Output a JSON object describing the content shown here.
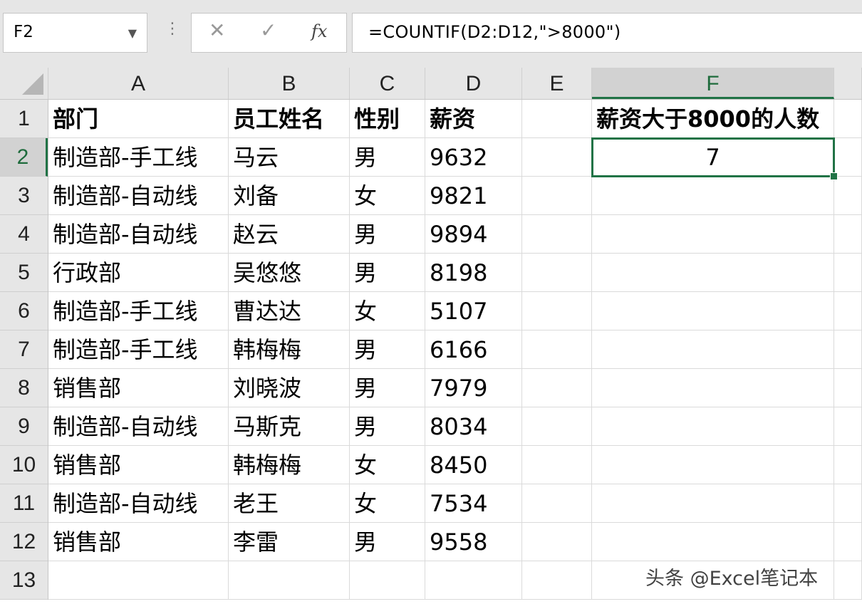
{
  "formula_bar": {
    "name_box": "F2",
    "name_box_arrow": "▼",
    "menu_dots": "⋮",
    "cancel_icon": "✕",
    "enter_icon": "✓",
    "fx_label": "fx",
    "formula": "=COUNTIF(D2:D12,\">8000\")"
  },
  "columns": [
    "A",
    "B",
    "C",
    "D",
    "E",
    "F"
  ],
  "active_column": "F",
  "rows": [
    "1",
    "2",
    "3",
    "4",
    "5",
    "6",
    "7",
    "8",
    "9",
    "10",
    "11",
    "12",
    "13"
  ],
  "active_row": "2",
  "table": {
    "headers": [
      "部门",
      "员工姓名",
      "性别",
      "薪资"
    ],
    "records": [
      [
        "制造部-手工线",
        "马云",
        "男",
        "9632"
      ],
      [
        "制造部-自动线",
        "刘备",
        "女",
        "9821"
      ],
      [
        "制造部-自动线",
        "赵云",
        "男",
        "9894"
      ],
      [
        "行政部",
        "吴悠悠",
        "男",
        "8198"
      ],
      [
        "制造部-手工线",
        "曹达达",
        "女",
        "5107"
      ],
      [
        "制造部-手工线",
        "韩梅梅",
        "男",
        "6166"
      ],
      [
        "销售部",
        "刘晓波",
        "男",
        "7979"
      ],
      [
        "制造部-自动线",
        "马斯克",
        "男",
        "8034"
      ],
      [
        "销售部",
        "韩梅梅",
        "女",
        "8450"
      ],
      [
        "制造部-自动线",
        "老王",
        "女",
        "7534"
      ],
      [
        "销售部",
        "李雷",
        "男",
        "9558"
      ]
    ]
  },
  "summary": {
    "label": "薪资大于8000的人数",
    "value": "7"
  },
  "watermark": "头条 @Excel笔记本",
  "colors": {
    "selection": "#217346",
    "header_bg": "#e6e6e6"
  }
}
